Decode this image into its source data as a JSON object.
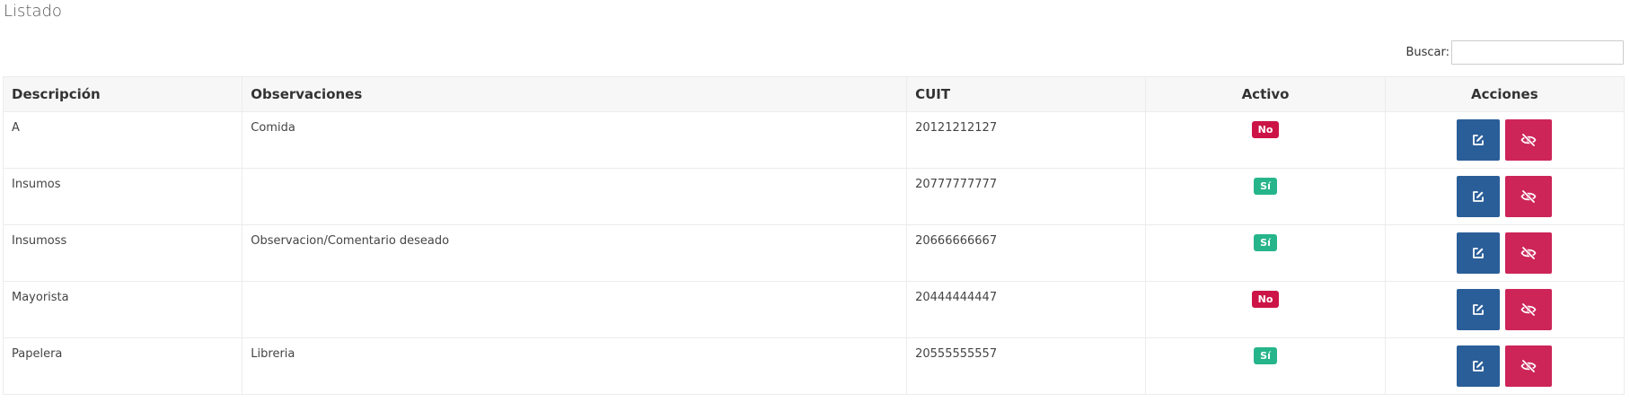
{
  "page": {
    "title": "Listado"
  },
  "search": {
    "label": "Buscar:",
    "value": "",
    "placeholder": ""
  },
  "table": {
    "headers": {
      "descripcion": "Descripción",
      "observaciones": "Observaciones",
      "cuit": "CUIT",
      "activo": "Activo",
      "acciones": "Acciones"
    },
    "rows": [
      {
        "descripcion": "A",
        "observaciones": "Comida",
        "cuit": "20121212127",
        "activo": "No",
        "activo_status": "no"
      },
      {
        "descripcion": "Insumos",
        "observaciones": "",
        "cuit": "20777777777",
        "activo": "Sí",
        "activo_status": "si"
      },
      {
        "descripcion": "Insumoss",
        "observaciones": "Observacion/Comentario deseado",
        "cuit": "20666666667",
        "activo": "Sí",
        "activo_status": "si"
      },
      {
        "descripcion": "Mayorista",
        "observaciones": "",
        "cuit": "20444444447",
        "activo": "No",
        "activo_status": "no"
      },
      {
        "descripcion": "Papelera",
        "observaciones": "Libreria",
        "cuit": "20555555557",
        "activo": "Sí",
        "activo_status": "si"
      }
    ],
    "actions": {
      "edit_icon": "edit-icon",
      "hide_icon": "eye-slash-icon"
    }
  },
  "colors": {
    "badge_no": "#cc1546",
    "badge_si": "#26b58b",
    "edit_button": "#2a5e98",
    "hide_button": "#cd2558"
  }
}
